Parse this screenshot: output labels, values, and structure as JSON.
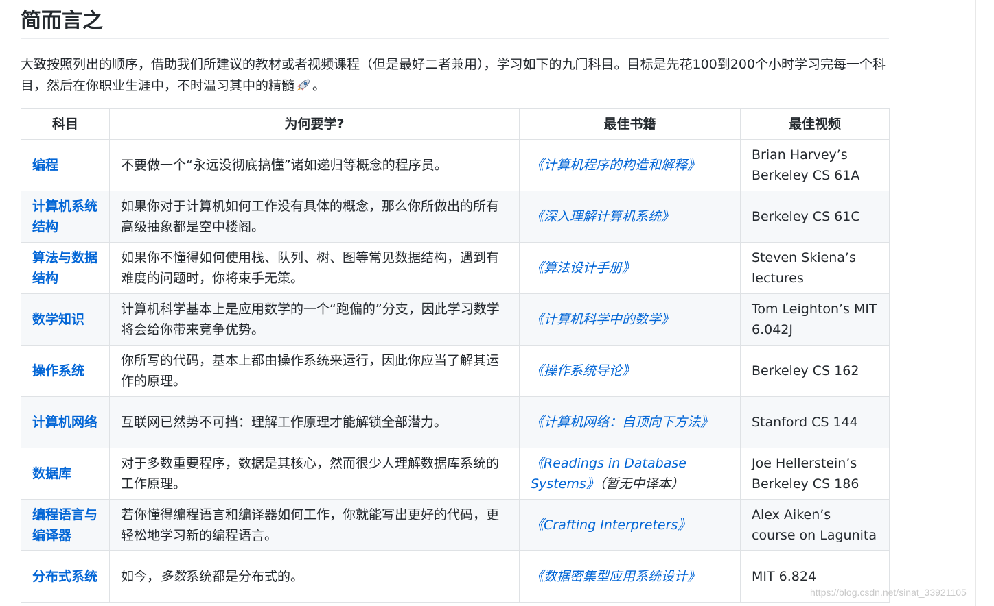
{
  "title": "简而言之",
  "intro": {
    "text": "大致按照列出的顺序，借助我们所建议的教材或者视频课程（但是最好二者兼用），学习如下的九门科目。目标是先花100到200个小时学习完每一个科目，然后在你职业生涯中，不时温习其中的精髓",
    "end": "。",
    "icon": "rocket-icon"
  },
  "table": {
    "headers": {
      "subject": "科目",
      "why": "为何要学?",
      "book": "最佳书籍",
      "video": "最佳视频"
    },
    "rows": [
      {
        "subject": "编程",
        "why": "不要做一个“永远没彻底搞懂”诸如递归等概念的程序员。",
        "book": "《计算机程序的构造和解释》",
        "video": "Brian Harvey’s Berkeley CS 61A"
      },
      {
        "subject": "计算机系统结构",
        "why": "如果你对于计算机如何工作没有具体的概念，那么你所做出的所有高级抽象都是空中楼阁。",
        "book": "《深入理解计算机系统》",
        "video": "Berkeley CS 61C"
      },
      {
        "subject": "算法与数据结构",
        "why": "如果你不懂得如何使用栈、队列、树、图等常见数据结构，遇到有难度的问题时，你将束手无策。",
        "book": "《算法设计手册》",
        "video": "Steven Skiena’s lectures"
      },
      {
        "subject": "数学知识",
        "why": "计算机科学基本上是应用数学的一个“跑偏的”分支，因此学习数学将会给你带来竞争优势。",
        "book": "《计算机科学中的数学》",
        "video": "Tom Leighton’s MIT 6.042J"
      },
      {
        "subject": "操作系统",
        "why": "你所写的代码，基本上都由操作系统来运行，因此你应当了解其运作的原理。",
        "book": "《操作系统导论》",
        "video": "Berkeley CS 162"
      },
      {
        "subject": "计算机网络",
        "why": "互联网已然势不可挡：理解工作原理才能解锁全部潜力。",
        "book": "《计算机网络：自顶向下方法》",
        "video": "Stanford CS 144"
      },
      {
        "subject": "数据库",
        "why": "对于多数重要程序，数据是其核心，然而很少人理解数据库系统的工作原理。",
        "book": "《Readings in Database Systems》",
        "book_note": "（暂无中译本）",
        "video": "Joe Hellerstein’s Berkeley CS 186"
      },
      {
        "subject": "编程语言与编译器",
        "why": "若你懂得编程语言和编译器如何工作，你就能写出更好的代码，更轻松地学习新的编程语言。",
        "book": "《Crafting Interpreters》",
        "video": "Alex Aiken’s course on Lagunita"
      },
      {
        "subject": "分布式系统",
        "why_prefix": "如今，",
        "why_em": "多数",
        "why_suffix": "系统都是分布式的。",
        "book": "《数据密集型应用系统设计》",
        "video": "MIT 6.824"
      }
    ]
  },
  "watermark": "https://blog.csdn.net/sinat_33921105",
  "colors": {
    "link": "#0366d6",
    "text": "#24292e",
    "border": "#dfe2e5",
    "stripe": "#f6f8fa"
  }
}
